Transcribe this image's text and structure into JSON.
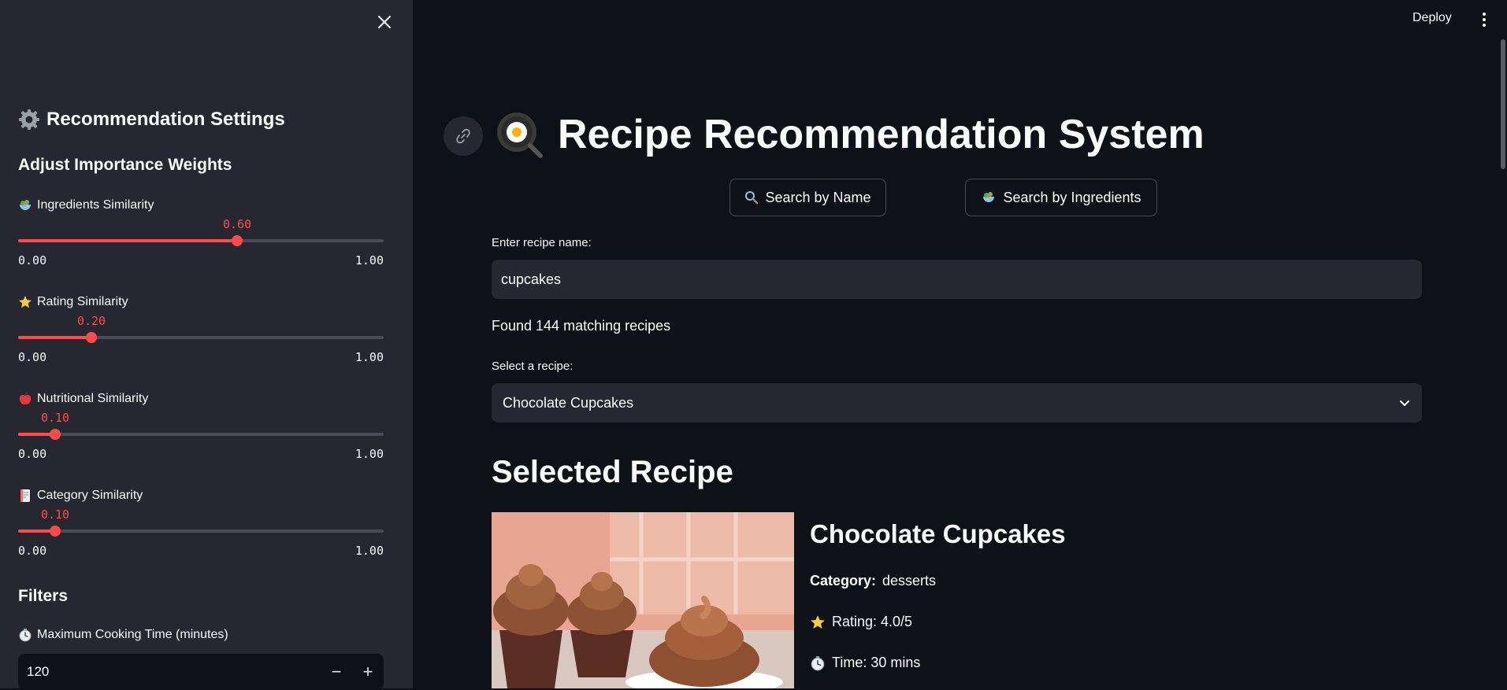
{
  "sidebar": {
    "title": "Recommendation Settings",
    "subtitle": "Adjust Importance Weights",
    "sliders": [
      {
        "label": "Ingredients Similarity",
        "value": 0.6,
        "value_text": "0.60",
        "min_text": "0.00",
        "max_text": "1.00",
        "icon": "salad-icon"
      },
      {
        "label": "Rating Similarity",
        "value": 0.2,
        "value_text": "0.20",
        "min_text": "0.00",
        "max_text": "1.00",
        "icon": "star-icon"
      },
      {
        "label": "Nutritional Similarity",
        "value": 0.1,
        "value_text": "0.10",
        "min_text": "0.00",
        "max_text": "1.00",
        "icon": "apple-icon"
      },
      {
        "label": "Category Similarity",
        "value": 0.1,
        "value_text": "0.10",
        "min_text": "0.00",
        "max_text": "1.00",
        "icon": "document-icon"
      }
    ],
    "filters_heading": "Filters",
    "cooking_time_label": "Maximum Cooking Time (minutes)",
    "cooking_time_value": "120",
    "minus": "−",
    "plus": "+"
  },
  "header": {
    "deploy_label": "Deploy"
  },
  "main": {
    "title": "Recipe Recommendation System",
    "tabs": [
      {
        "label": "Search by Name",
        "icon": "magnifier-icon"
      },
      {
        "label": "Search by Ingredients",
        "icon": "salad-icon"
      }
    ],
    "name_label": "Enter recipe name:",
    "name_value": "cupcakes",
    "found_text": "Found 144 matching recipes",
    "select_label": "Select a recipe:",
    "select_value": "Chocolate Cupcakes",
    "selected_heading": "Selected Recipe",
    "recipe": {
      "name": "Chocolate Cupcakes",
      "category_label": "Category:",
      "category_value": "desserts",
      "rating_text": "Rating: 4.0/5",
      "time_text": "Time: 30 mins"
    }
  },
  "colors": {
    "accent": "#ff4b4b",
    "background": "#0e1117",
    "sidebar": "#262730"
  }
}
